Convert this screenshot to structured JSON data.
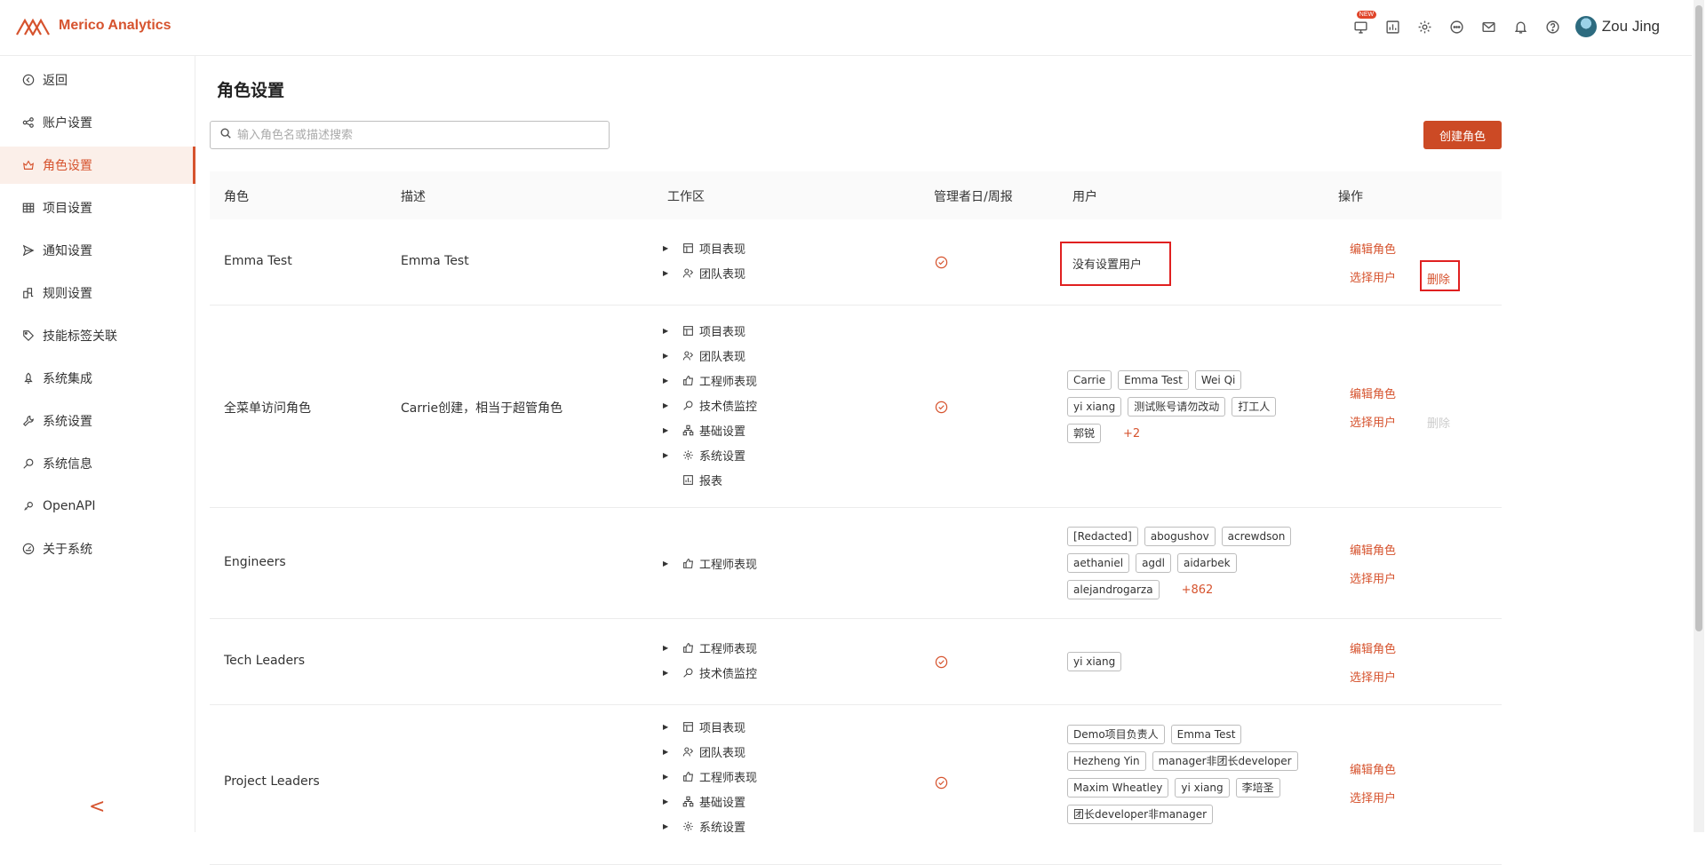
{
  "app": {
    "name": "Merico Analytics",
    "user": "Zou Jing",
    "new_badge": "NEW",
    "brand_color": "#d6532e"
  },
  "sidebar": {
    "items": [
      {
        "label": "返回",
        "icon": "back-circle-icon"
      },
      {
        "label": "账户设置",
        "icon": "share-nodes-icon"
      },
      {
        "label": "角色设置",
        "icon": "role-icon"
      },
      {
        "label": "项目设置",
        "icon": "table-icon"
      },
      {
        "label": "通知设置",
        "icon": "send-icon"
      },
      {
        "label": "规则设置",
        "icon": "rule-icon"
      },
      {
        "label": "技能标签关联",
        "icon": "tag-icon"
      },
      {
        "label": "系统集成",
        "icon": "rocket-icon"
      },
      {
        "label": "系统设置",
        "icon": "wrench-icon"
      },
      {
        "label": "系统信息",
        "icon": "search-doc-icon"
      },
      {
        "label": "OpenAPI",
        "icon": "api-icon"
      },
      {
        "label": "关于系统",
        "icon": "gauge-icon"
      }
    ],
    "collapse_glyph": "<"
  },
  "main": {
    "title": "角色设置",
    "search_placeholder": "输入角色名或描述搜索",
    "create_button": "创建角色",
    "columns": [
      "角色",
      "描述",
      "工作区",
      "管理者日/周报",
      "用户",
      "操作"
    ],
    "edit_label": "编辑角色",
    "select_user_label": "选择用户",
    "delete_label": "删除",
    "no_user_label": "没有设置用户"
  },
  "rows": [
    {
      "role": "Emma Test",
      "desc": "Emma Test",
      "workspaces": [
        "项目表现",
        "团队表现"
      ],
      "report": true,
      "users": [],
      "more": "",
      "delete_enabled": true
    },
    {
      "role": "全菜单访问角色",
      "desc": "Carrie创建，相当于超管角色",
      "workspaces": [
        "项目表现",
        "团队表现",
        "工程师表现",
        "技术债监控",
        "基础设置",
        "系统设置",
        "报表"
      ],
      "report": true,
      "user_lines": [
        [
          "Carrie",
          "Emma Test",
          "Wei Qi"
        ],
        [
          "yi xiang",
          "测试账号请勿改动",
          "打工人"
        ],
        [
          "郭锐"
        ]
      ],
      "more": "+2",
      "delete_enabled": false
    },
    {
      "role": "Engineers",
      "desc": "",
      "workspaces": [
        "工程师表现"
      ],
      "report": false,
      "user_lines": [
        [
          "[Redacted]",
          "abogushov",
          "acrewdson"
        ],
        [
          "aethaniel",
          "agdl",
          "aidarbek"
        ],
        [
          "alejandrogarza"
        ]
      ],
      "more": "+862",
      "delete_enabled": false
    },
    {
      "role": "Tech Leaders",
      "desc": "",
      "workspaces": [
        "工程师表现",
        "技术债监控"
      ],
      "report": true,
      "user_lines": [
        [
          "yi xiang"
        ]
      ],
      "more": "",
      "delete_enabled": false
    },
    {
      "role": "Project Leaders",
      "desc": "",
      "workspaces": [
        "项目表现",
        "团队表现",
        "工程师表现",
        "基础设置",
        "系统设置"
      ],
      "report": true,
      "user_lines": [
        [
          "Demo项目负责人",
          "Emma Test"
        ],
        [
          "Hezheng Yin",
          "manager非团长developer"
        ],
        [
          "Maxim Wheatley",
          "yi xiang",
          "李培圣"
        ],
        [
          "团长developer非manager"
        ]
      ],
      "more": "",
      "delete_enabled": false
    }
  ]
}
